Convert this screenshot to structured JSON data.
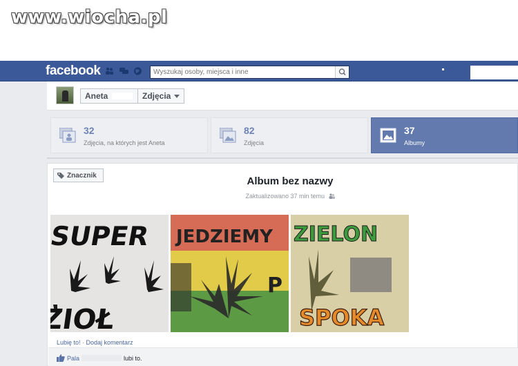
{
  "watermark": "www.wiocha.pl",
  "topbar": {
    "logo": "facebook",
    "search_placeholder": "Wyszukaj osoby, miejsca i inne"
  },
  "breadcrumb": {
    "name": "Aneta",
    "section": "Zdjęcia"
  },
  "tabs": [
    {
      "count": "32",
      "label": "Zdjęcia, na których jest Aneta"
    },
    {
      "count": "82",
      "label": "Zdjęcia"
    },
    {
      "count": "37",
      "label": "Albumy"
    }
  ],
  "album": {
    "tag_button": "Znacznik",
    "title": "Album bez nazwy",
    "updated": "Zaktualizowano 37 min temu"
  },
  "photos": [
    {
      "caption_lines": [
        "SUPER",
        "ZIOŁ"
      ]
    },
    {
      "caption_lines": [
        "JEDZIEMY",
        "P"
      ]
    },
    {
      "caption_lines": [
        "ZIELON",
        "SPOKA"
      ]
    }
  ],
  "actions": {
    "like": "Lubię to!",
    "separator": " · ",
    "comment": "Dodaj komentarz"
  },
  "likes": {
    "name": "Pala",
    "suffix": "lubi to."
  },
  "colors": {
    "fb_blue": "#3b5998",
    "tab_active": "#627aad",
    "link": "#4b67a1"
  }
}
